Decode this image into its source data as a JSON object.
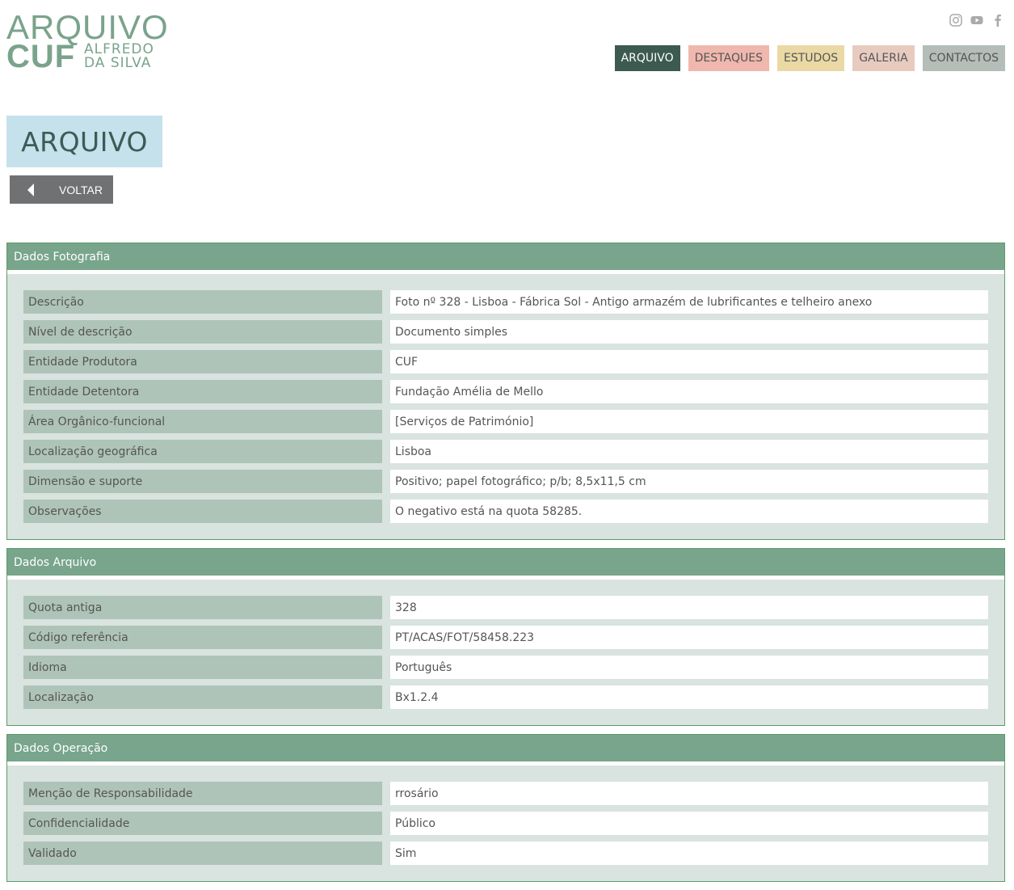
{
  "logo": {
    "line1": "ARQUIVO",
    "line2": "CUF",
    "sub1": "ALFREDO",
    "sub2": "DA SILVA"
  },
  "social": [
    "instagram-icon",
    "youtube-icon",
    "facebook-icon"
  ],
  "nav": {
    "arquivo": "ARQUIVO",
    "destaques": "DESTAQUES",
    "estudos": "ESTUDOS",
    "galeria": "GALERIA",
    "contactos": "CONTACTOS"
  },
  "page_title": "ARQUIVO",
  "back_label": "VOLTAR",
  "sections": [
    {
      "title": "Dados Fotografia",
      "rows": [
        {
          "label": "Descrição",
          "value": "Foto nº 328 - Lisboa - Fábrica Sol - Antigo armazém de lubrificantes e telheiro anexo"
        },
        {
          "label": "Nível de descrição",
          "value": "Documento simples"
        },
        {
          "label": "Entidade Produtora",
          "value": "CUF"
        },
        {
          "label": "Entidade Detentora",
          "value": "Fundação Amélia de Mello"
        },
        {
          "label": "Área Orgânico-funcional",
          "value": "[Serviços de Património]"
        },
        {
          "label": "Localização geográfica",
          "value": "Lisboa"
        },
        {
          "label": "Dimensão e suporte",
          "value": "Positivo; papel fotográfico; p/b; 8,5x11,5 cm"
        },
        {
          "label": "Observações",
          "value": "O negativo está na quota 58285."
        }
      ]
    },
    {
      "title": "Dados Arquivo",
      "rows": [
        {
          "label": "Quota antiga",
          "value": "328"
        },
        {
          "label": "Código referência",
          "value": "PT/ACAS/FOT/58458.223"
        },
        {
          "label": "Idioma",
          "value": "Português"
        },
        {
          "label": "Localização",
          "value": "Bx1.2.4"
        }
      ]
    },
    {
      "title": "Dados Operação",
      "rows": [
        {
          "label": "Menção de Responsabilidade",
          "value": "rrosário"
        },
        {
          "label": "Confidencialidade",
          "value": "Público"
        },
        {
          "label": "Validado",
          "value": "Sim"
        }
      ]
    }
  ]
}
